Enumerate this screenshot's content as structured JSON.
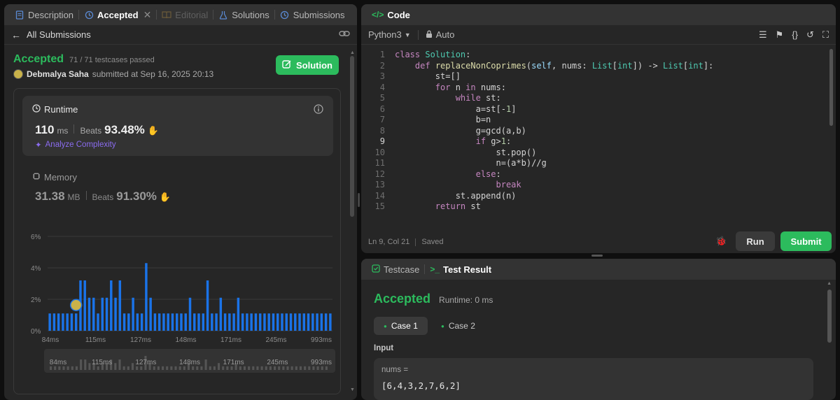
{
  "left_tabs": {
    "description": "Description",
    "accepted": "Accepted",
    "editorial": "Editorial",
    "solutions": "Solutions",
    "submissions": "Submissions"
  },
  "subbar": {
    "back_label": "All Submissions"
  },
  "submission": {
    "status": "Accepted",
    "testcases": "71 / 71 testcases passed",
    "user": "Debmalya Saha",
    "submitted_at": "submitted at Sep 16, 2025 20:13",
    "solution_button": "Solution"
  },
  "runtime": {
    "title": "Runtime",
    "value": "110",
    "unit": "ms",
    "beats_label": "Beats",
    "beats": "93.48%",
    "analyze": "Analyze Complexity"
  },
  "memory": {
    "title": "Memory",
    "value": "31.38",
    "unit": "MB",
    "beats_label": "Beats",
    "beats": "91.30%"
  },
  "chart_data": {
    "type": "bar",
    "ylabel_ticks": [
      "6%",
      "4%",
      "2%",
      "0%"
    ],
    "ylim": [
      0,
      6
    ],
    "x_tick_labels": [
      "84ms",
      "115ms",
      "127ms",
      "148ms",
      "171ms",
      "245ms",
      "993ms"
    ],
    "values": [
      1.1,
      1.1,
      1.1,
      1.1,
      1.1,
      1.1,
      1.1,
      3.2,
      3.2,
      2.1,
      2.1,
      1.1,
      2.1,
      2.1,
      3.2,
      2.1,
      3.2,
      1.1,
      1.1,
      2.1,
      1.1,
      1.1,
      4.3,
      2.1,
      1.1,
      1.1,
      1.1,
      1.1,
      1.1,
      1.1,
      1.1,
      1.1,
      2.1,
      1.1,
      1.1,
      1.1,
      3.2,
      1.1,
      1.1,
      2.1,
      1.1,
      1.1,
      1.1,
      2.1,
      1.1,
      1.1,
      1.1,
      1.1,
      1.1,
      1.1,
      1.1,
      1.1,
      1.1,
      1.1,
      1.1,
      1.1,
      1.1,
      1.1,
      1.1,
      1.1,
      1.1,
      1.1,
      1.1,
      1.1,
      1.1
    ],
    "highlight_index": 6,
    "colors": {
      "bar": "#1a73e8",
      "grid": "#3a3a3a"
    }
  },
  "code_panel": {
    "title": "Code",
    "language": "Python3",
    "auto": "Auto",
    "lines": [
      "class Solution:",
      "    def replaceNonCoprimes(self, nums: List[int]) -> List[int]:",
      "        st=[]",
      "        for n in nums:",
      "            while st:",
      "                a=st[-1]",
      "                b=n",
      "                g=gcd(a,b)",
      "                if g>1:",
      "                    st.pop()",
      "                    n=(a*b)//g",
      "                else:",
      "                    break",
      "            st.append(n)",
      "        return st"
    ],
    "status_pos": "Ln 9, Col 21",
    "status_saved": "Saved",
    "run": "Run",
    "submit": "Submit"
  },
  "result_panel": {
    "tab_testcase": "Testcase",
    "tab_result": "Test Result",
    "status": "Accepted",
    "runtime": "Runtime: 0 ms",
    "case1": "Case 1",
    "case2": "Case 2",
    "input_label": "Input",
    "var_name": "nums =",
    "var_value": "[6,4,3,2,7,6,2]"
  }
}
